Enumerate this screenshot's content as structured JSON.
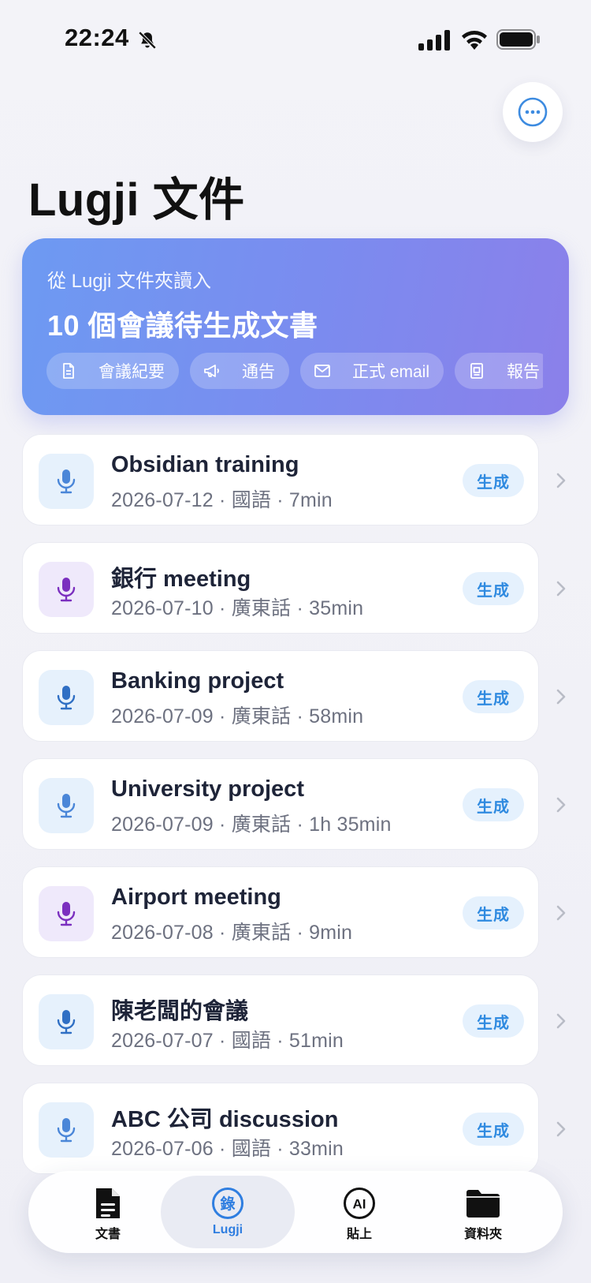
{
  "status_bar": {
    "time": "22:24"
  },
  "header": {
    "title": "Lugji 文件"
  },
  "hero": {
    "subtitle": "從 Lugji 文件夾讀入",
    "title": "10 個會議待生成文書",
    "chips": [
      {
        "label": "會議紀要",
        "icon": "document-icon"
      },
      {
        "label": "通告",
        "icon": "megaphone-icon"
      },
      {
        "label": "正式 email",
        "icon": "envelope-icon"
      },
      {
        "label": "報告",
        "icon": "report-icon"
      }
    ]
  },
  "meetings": [
    {
      "title": "Obsidian training",
      "meta": "2026-07-12 · 國語 · 7min",
      "mic_color": "blue",
      "action": "生成"
    },
    {
      "title": "銀行 meeting",
      "meta": "2026-07-10 · 廣東話 · 35min",
      "mic_color": "purple",
      "action": "生成"
    },
    {
      "title": "Banking project",
      "meta": "2026-07-09 · 廣東話 · 58min",
      "mic_color": "blue",
      "action": "生成"
    },
    {
      "title": "University project",
      "meta": "2026-07-09 · 廣東話 · 1h 35min",
      "mic_color": "blue",
      "action": "生成"
    },
    {
      "title": "Airport meeting",
      "meta": "2026-07-08 · 廣東話 · 9min",
      "mic_color": "purple",
      "action": "生成"
    },
    {
      "title": "陳老闆的會議",
      "meta": "2026-07-07 · 國語 · 51min",
      "mic_color": "blue",
      "action": "生成"
    },
    {
      "title": "ABC 公司 discussion",
      "meta": "2026-07-06 · 國語 · 33min",
      "mic_color": "blue",
      "action": "生成"
    }
  ],
  "tabbar": {
    "tabs": [
      {
        "label": "文書",
        "icon": "document-icon"
      },
      {
        "label": "Lugji",
        "icon": "lugji-record-icon",
        "active": true
      },
      {
        "label": "貼上",
        "icon": "ai-icon"
      },
      {
        "label": "資料夾",
        "icon": "folder-icon"
      }
    ]
  },
  "colors": {
    "accent_blue": "#2f8ae0",
    "mic_blue": "#4a86d8",
    "mic_purple": "#7b2fbf",
    "hero_gradient_start": "#6d9af2",
    "hero_gradient_end": "#8b80ea"
  }
}
